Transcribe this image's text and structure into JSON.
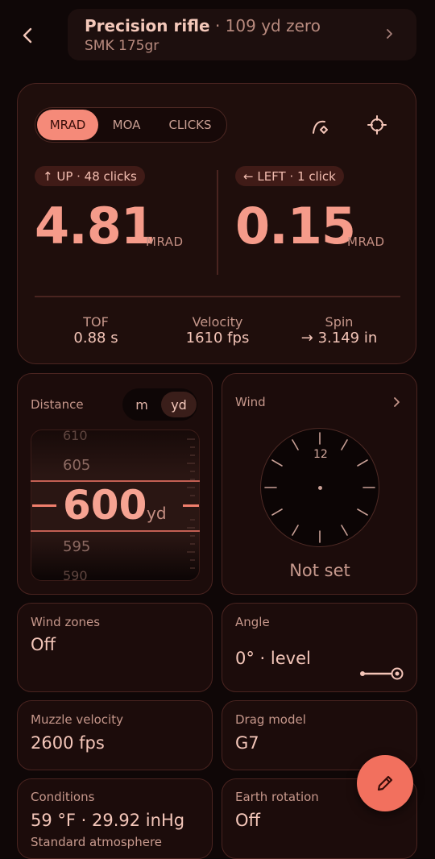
{
  "header": {
    "title": "Precision rifle",
    "title_suffix": "· 109 yd zero",
    "subtitle": "SMK 175gr"
  },
  "units_segment": {
    "options": [
      "MRAD",
      "MOA",
      "CLICKS"
    ],
    "selected": "MRAD"
  },
  "elevation": {
    "chip": "↑ UP · 48 clicks",
    "value": "4.81",
    "unit": "MRAD"
  },
  "windage": {
    "chip": "← LEFT · 1 click",
    "value": "0.15",
    "unit": "MRAD"
  },
  "stats": {
    "tof": {
      "label": "TOF",
      "value": "0.88 s"
    },
    "velocity": {
      "label": "Velocity",
      "value": "1610 fps"
    },
    "spin": {
      "label": "Spin",
      "value": "→ 3.149 in"
    }
  },
  "distance": {
    "label": "Distance",
    "units": [
      "m",
      "yd"
    ],
    "selected_unit": "yd",
    "value": "600",
    "unit": "yd",
    "ticks": [
      "610",
      "605",
      "595",
      "590"
    ]
  },
  "wind": {
    "label": "Wind",
    "dial_label": "12",
    "status": "Not set"
  },
  "cards": {
    "wind_zones": {
      "label": "Wind zones",
      "value": "Off"
    },
    "angle": {
      "label": "Angle",
      "value": "0° · level"
    },
    "muzzle_velocity": {
      "label": "Muzzle velocity",
      "value": "2600 fps"
    },
    "drag_model": {
      "label": "Drag model",
      "value": "G7"
    },
    "conditions": {
      "label": "Conditions",
      "value": "59 °F · 29.92 inHg",
      "note": "Standard atmosphere"
    },
    "earth_rotation": {
      "label": "Earth rotation",
      "value": "Off"
    }
  },
  "icons": {
    "back": "chevron-left-icon",
    "header_forward": "chevron-right-icon",
    "trajectory": "trajectory-icon",
    "target": "crosshair-icon",
    "wind_forward": "chevron-right-icon",
    "fab": "pencil-icon"
  },
  "colors": {
    "accent": "#f58a79",
    "fab": "#f2705e",
    "background": "#0f0707"
  }
}
